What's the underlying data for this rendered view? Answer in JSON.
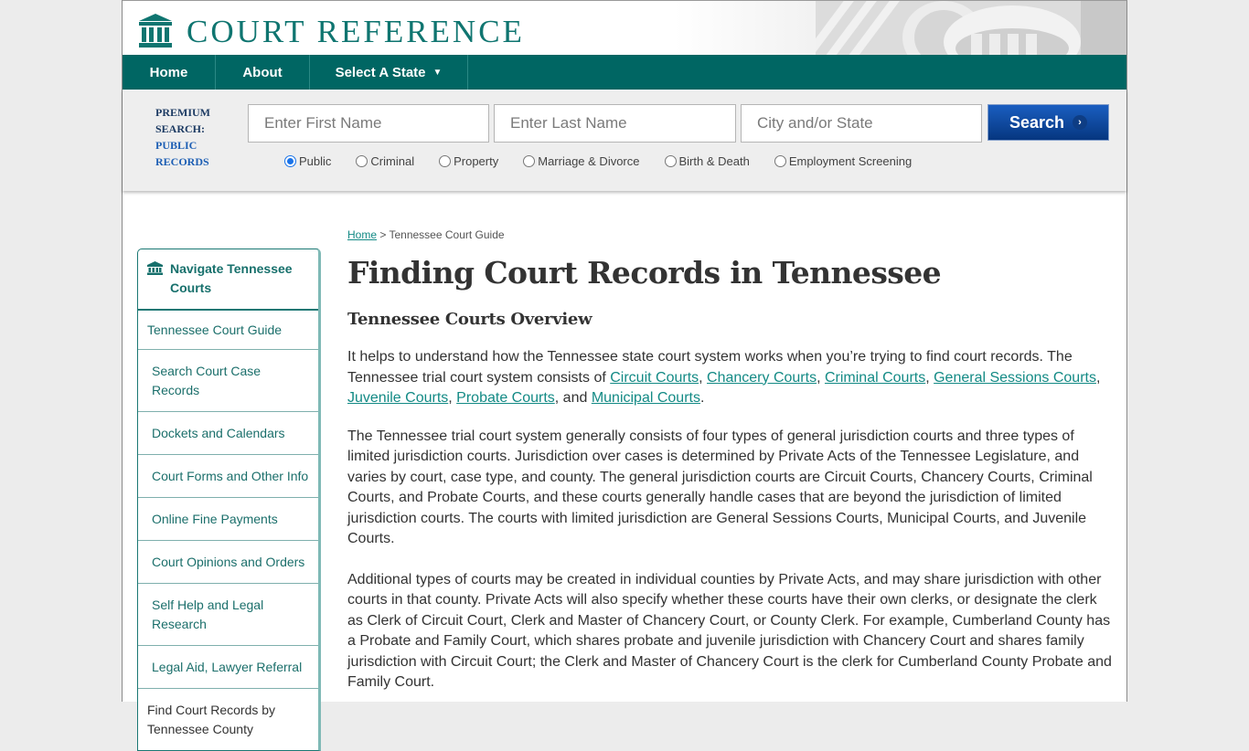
{
  "header": {
    "logo_text": "COURT REFERENCE",
    "brand_color": "#0f7570"
  },
  "nav": {
    "items": [
      {
        "label": "Home"
      },
      {
        "label": "About"
      },
      {
        "label": "Select A State"
      }
    ],
    "dropdown_caret": "▼",
    "bg_color": "#006663"
  },
  "search": {
    "premium_line1": "PREMIUM",
    "premium_line2": "SEARCH:",
    "premium_line3": "PUBLIC",
    "premium_line4": "RECORDS",
    "first_name_placeholder": "Enter First Name",
    "last_name_placeholder": "Enter Last Name",
    "city_placeholder": "City and/or State",
    "button_label": "Search",
    "button_arrow": "›",
    "radio_options": [
      {
        "label": "Public",
        "checked": true
      },
      {
        "label": "Criminal",
        "checked": false
      },
      {
        "label": "Property",
        "checked": false
      },
      {
        "label": "Marriage & Divorce",
        "checked": false
      },
      {
        "label": "Birth & Death",
        "checked": false
      },
      {
        "label": "Employment Screening",
        "checked": false
      }
    ]
  },
  "sidebar": {
    "heading": "Navigate Tennessee Courts",
    "items": [
      {
        "label": "Tennessee Court Guide"
      },
      {
        "label": "Search Court Case Records"
      },
      {
        "label": "Dockets and Calendars"
      },
      {
        "label": "Court Forms and Other Info"
      },
      {
        "label": "Online Fine Payments"
      },
      {
        "label": "Court Opinions and Orders"
      },
      {
        "label": "Self Help and Legal Research"
      },
      {
        "label": "Legal Aid, Lawyer Referral"
      },
      {
        "label": "Find Court Records by Tennessee County"
      }
    ]
  },
  "main": {
    "breadcrumb": {
      "home": "Home",
      "separator": " > ",
      "current": "Tennessee Court Guide"
    },
    "title": "Finding Court Records in Tennessee",
    "subtitle": "Tennessee Courts Overview",
    "para1": {
      "intro": "It helps to understand how the Tennessee state court system works when you’re trying to find court records. The Tennessee trial court system consists of ",
      "links": [
        "Circuit Courts",
        "Chancery Courts",
        "Criminal Courts",
        "General Sessions Courts",
        "Juvenile Courts",
        "Probate Courts",
        "Municipal Courts"
      ],
      "sep": ", ",
      "and": ", and ",
      "end": "."
    },
    "para2": "The Tennessee trial court system generally consists of four types of general jurisdiction courts and three types of limited jurisdiction courts. Jurisdiction over cases is determined by Private Acts of the Tennessee Legislature, and varies by court, case type, and county. The general jurisdiction courts are Circuit Courts, Chancery Courts, Criminal Courts, and Probate Courts, and these courts generally handle cases that are beyond the jurisdiction of limited jurisdiction courts. The courts with limited jurisdiction are General Sessions Courts, Municipal Courts, and Juvenile Courts.",
    "para3": "Additional types of courts may be created in individual counties by Private Acts, and may share jurisdiction with other courts in that county. Private Acts will also specify whether these courts have their own clerks, or designate the clerk as Clerk of Circuit Court, Clerk and Master of Chancery Court, or County Clerk. For example, Cumberland County has a Probate and Family Court, which shares probate and juvenile jurisdiction with Chancery Court and shares family jurisdiction with Circuit Court; the Clerk and Master of Chancery Court is the clerk for Cumberland County Probate and Family Court."
  }
}
